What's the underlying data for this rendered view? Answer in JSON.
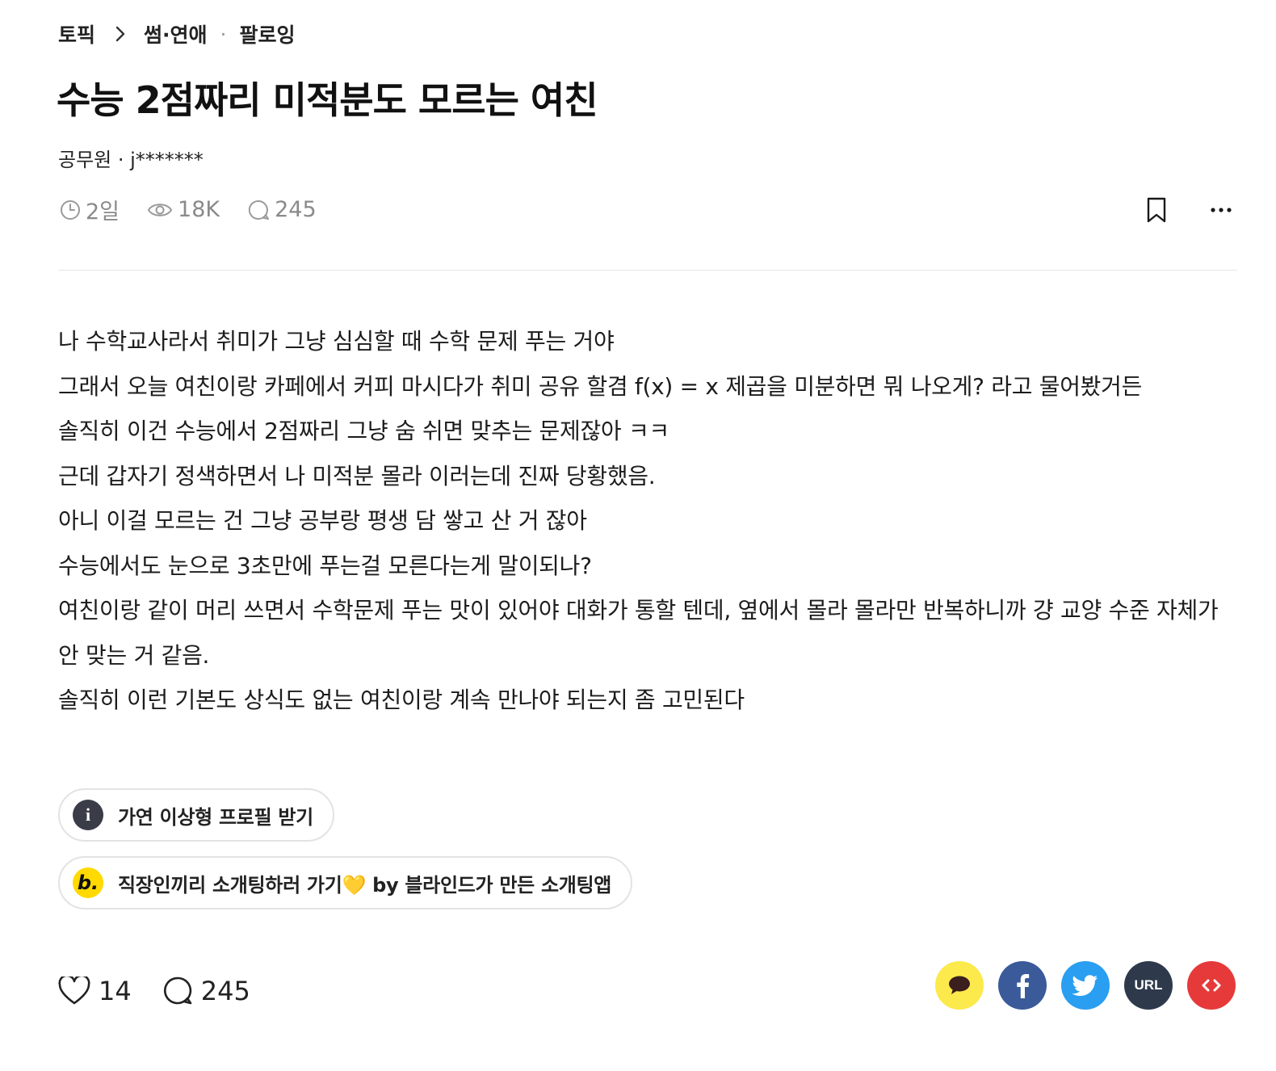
{
  "breadcrumb": {
    "root": "토픽",
    "category": "썸·연애",
    "follow": "팔로잉"
  },
  "post": {
    "title": "수능 2점짜리 미적분도 모르는 여친",
    "author": "공무원 · j*******",
    "time": "2일",
    "views": "18K",
    "comments": "245",
    "body": [
      "나 수학교사라서 취미가 그냥 심심할 때 수학 문제 푸는 거야",
      "그래서 오늘 여친이랑 카페에서 커피 마시다가 취미 공유 할겸 f(x) = x 제곱을 미분하면 뭐 나오게? 라고 물어봤거든",
      "솔직히 이건 수능에서 2점짜리 그냥 숨 쉬면 맞추는 문제잖아 ㅋㅋ",
      "근데 갑자기 정색하면서 나 미적분 몰라 이러는데 진짜 당황했음.",
      "아니 이걸 모르는 건 그냥 공부랑 평생 담 쌓고 산 거 잖아",
      "수능에서도 눈으로 3초만에 푸는걸 모른다는게 말이되나?",
      "여친이랑 같이 머리 쓰면서 수학문제 푸는 맛이 있어야 대화가 통할 텐데, 옆에서 몰라 몰라만 반복하니까 걍 교양 수준 자체가 안 맞는 거 같음.",
      "솔직히 이런 기본도 상식도 없는 여친이랑 계속 만나야 되는지 좀 고민된다"
    ]
  },
  "promos": [
    {
      "icon": "info-icon",
      "icon_text": "i",
      "label": "가연 이상형 프로필 받기"
    },
    {
      "icon": "blind-b-icon",
      "icon_text": "b.",
      "label": "직장인끼리 소개팅하러 가기💛 by 블라인드가 만든 소개팅앱"
    }
  ],
  "reactions": {
    "likes": "14",
    "comments": "245"
  },
  "share": {
    "url_label": "URL",
    "colors": {
      "kakao": "#fce94c",
      "facebook": "#3a5a9a",
      "twitter": "#2a9ef0",
      "url": "#2e3a4c",
      "embed": "#e63a3a"
    }
  }
}
